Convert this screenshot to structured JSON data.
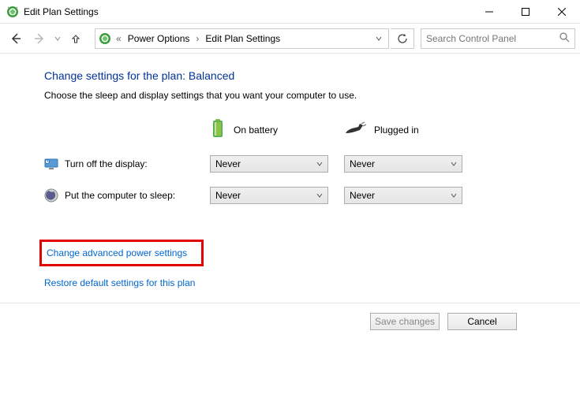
{
  "window": {
    "title": "Edit Plan Settings"
  },
  "nav": {
    "breadcrumb": [
      "Power Options",
      "Edit Plan Settings"
    ],
    "search_placeholder": "Search Control Panel"
  },
  "page": {
    "title": "Change settings for the plan: Balanced",
    "description": "Choose the sleep and display settings that you want your computer to use.",
    "columns": {
      "battery": "On battery",
      "plugged": "Plugged in"
    },
    "rows": {
      "display": {
        "label": "Turn off the display:",
        "battery_value": "Never",
        "plugged_value": "Never"
      },
      "sleep": {
        "label": "Put the computer to sleep:",
        "battery_value": "Never",
        "plugged_value": "Never"
      }
    },
    "links": {
      "advanced": "Change advanced power settings",
      "restore": "Restore default settings for this plan"
    },
    "buttons": {
      "save": "Save changes",
      "cancel": "Cancel"
    }
  }
}
